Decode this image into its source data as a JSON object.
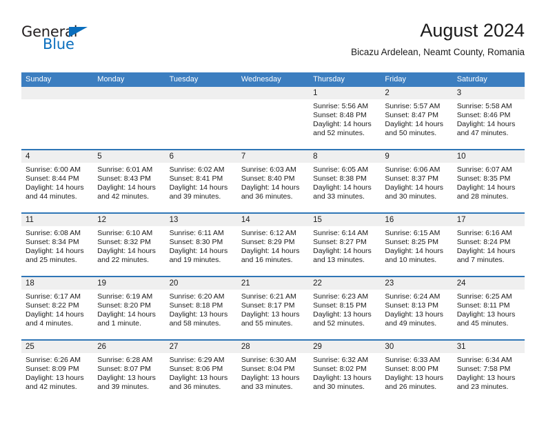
{
  "logo": {
    "word_top": "General",
    "word_bottom": "Blue",
    "triangle_icon": "triangle-icon",
    "color_dark": "#231f20",
    "color_blue": "#0a6ebd"
  },
  "header": {
    "title": "August 2024",
    "subtitle": "Bicazu Ardelean, Neamt County, Romania"
  },
  "colors": {
    "header_blue": "#3c7ec0",
    "separator_blue": "#2e75b6",
    "daynum_band": "#efefef",
    "text": "#1a1a1a"
  },
  "weekdays": [
    "Sunday",
    "Monday",
    "Tuesday",
    "Wednesday",
    "Thursday",
    "Friday",
    "Saturday"
  ],
  "weeks": [
    [
      {
        "day": "",
        "lines": []
      },
      {
        "day": "",
        "lines": []
      },
      {
        "day": "",
        "lines": []
      },
      {
        "day": "",
        "lines": []
      },
      {
        "day": "1",
        "lines": [
          "Sunrise: 5:56 AM",
          "Sunset: 8:48 PM",
          "Daylight: 14 hours",
          "and 52 minutes."
        ]
      },
      {
        "day": "2",
        "lines": [
          "Sunrise: 5:57 AM",
          "Sunset: 8:47 PM",
          "Daylight: 14 hours",
          "and 50 minutes."
        ]
      },
      {
        "day": "3",
        "lines": [
          "Sunrise: 5:58 AM",
          "Sunset: 8:46 PM",
          "Daylight: 14 hours",
          "and 47 minutes."
        ]
      }
    ],
    [
      {
        "day": "4",
        "lines": [
          "Sunrise: 6:00 AM",
          "Sunset: 8:44 PM",
          "Daylight: 14 hours",
          "and 44 minutes."
        ]
      },
      {
        "day": "5",
        "lines": [
          "Sunrise: 6:01 AM",
          "Sunset: 8:43 PM",
          "Daylight: 14 hours",
          "and 42 minutes."
        ]
      },
      {
        "day": "6",
        "lines": [
          "Sunrise: 6:02 AM",
          "Sunset: 8:41 PM",
          "Daylight: 14 hours",
          "and 39 minutes."
        ]
      },
      {
        "day": "7",
        "lines": [
          "Sunrise: 6:03 AM",
          "Sunset: 8:40 PM",
          "Daylight: 14 hours",
          "and 36 minutes."
        ]
      },
      {
        "day": "8",
        "lines": [
          "Sunrise: 6:05 AM",
          "Sunset: 8:38 PM",
          "Daylight: 14 hours",
          "and 33 minutes."
        ]
      },
      {
        "day": "9",
        "lines": [
          "Sunrise: 6:06 AM",
          "Sunset: 8:37 PM",
          "Daylight: 14 hours",
          "and 30 minutes."
        ]
      },
      {
        "day": "10",
        "lines": [
          "Sunrise: 6:07 AM",
          "Sunset: 8:35 PM",
          "Daylight: 14 hours",
          "and 28 minutes."
        ]
      }
    ],
    [
      {
        "day": "11",
        "lines": [
          "Sunrise: 6:08 AM",
          "Sunset: 8:34 PM",
          "Daylight: 14 hours",
          "and 25 minutes."
        ]
      },
      {
        "day": "12",
        "lines": [
          "Sunrise: 6:10 AM",
          "Sunset: 8:32 PM",
          "Daylight: 14 hours",
          "and 22 minutes."
        ]
      },
      {
        "day": "13",
        "lines": [
          "Sunrise: 6:11 AM",
          "Sunset: 8:30 PM",
          "Daylight: 14 hours",
          "and 19 minutes."
        ]
      },
      {
        "day": "14",
        "lines": [
          "Sunrise: 6:12 AM",
          "Sunset: 8:29 PM",
          "Daylight: 14 hours",
          "and 16 minutes."
        ]
      },
      {
        "day": "15",
        "lines": [
          "Sunrise: 6:14 AM",
          "Sunset: 8:27 PM",
          "Daylight: 14 hours",
          "and 13 minutes."
        ]
      },
      {
        "day": "16",
        "lines": [
          "Sunrise: 6:15 AM",
          "Sunset: 8:25 PM",
          "Daylight: 14 hours",
          "and 10 minutes."
        ]
      },
      {
        "day": "17",
        "lines": [
          "Sunrise: 6:16 AM",
          "Sunset: 8:24 PM",
          "Daylight: 14 hours",
          "and 7 minutes."
        ]
      }
    ],
    [
      {
        "day": "18",
        "lines": [
          "Sunrise: 6:17 AM",
          "Sunset: 8:22 PM",
          "Daylight: 14 hours",
          "and 4 minutes."
        ]
      },
      {
        "day": "19",
        "lines": [
          "Sunrise: 6:19 AM",
          "Sunset: 8:20 PM",
          "Daylight: 14 hours",
          "and 1 minute."
        ]
      },
      {
        "day": "20",
        "lines": [
          "Sunrise: 6:20 AM",
          "Sunset: 8:18 PM",
          "Daylight: 13 hours",
          "and 58 minutes."
        ]
      },
      {
        "day": "21",
        "lines": [
          "Sunrise: 6:21 AM",
          "Sunset: 8:17 PM",
          "Daylight: 13 hours",
          "and 55 minutes."
        ]
      },
      {
        "day": "22",
        "lines": [
          "Sunrise: 6:23 AM",
          "Sunset: 8:15 PM",
          "Daylight: 13 hours",
          "and 52 minutes."
        ]
      },
      {
        "day": "23",
        "lines": [
          "Sunrise: 6:24 AM",
          "Sunset: 8:13 PM",
          "Daylight: 13 hours",
          "and 49 minutes."
        ]
      },
      {
        "day": "24",
        "lines": [
          "Sunrise: 6:25 AM",
          "Sunset: 8:11 PM",
          "Daylight: 13 hours",
          "and 45 minutes."
        ]
      }
    ],
    [
      {
        "day": "25",
        "lines": [
          "Sunrise: 6:26 AM",
          "Sunset: 8:09 PM",
          "Daylight: 13 hours",
          "and 42 minutes."
        ]
      },
      {
        "day": "26",
        "lines": [
          "Sunrise: 6:28 AM",
          "Sunset: 8:07 PM",
          "Daylight: 13 hours",
          "and 39 minutes."
        ]
      },
      {
        "day": "27",
        "lines": [
          "Sunrise: 6:29 AM",
          "Sunset: 8:06 PM",
          "Daylight: 13 hours",
          "and 36 minutes."
        ]
      },
      {
        "day": "28",
        "lines": [
          "Sunrise: 6:30 AM",
          "Sunset: 8:04 PM",
          "Daylight: 13 hours",
          "and 33 minutes."
        ]
      },
      {
        "day": "29",
        "lines": [
          "Sunrise: 6:32 AM",
          "Sunset: 8:02 PM",
          "Daylight: 13 hours",
          "and 30 minutes."
        ]
      },
      {
        "day": "30",
        "lines": [
          "Sunrise: 6:33 AM",
          "Sunset: 8:00 PM",
          "Daylight: 13 hours",
          "and 26 minutes."
        ]
      },
      {
        "day": "31",
        "lines": [
          "Sunrise: 6:34 AM",
          "Sunset: 7:58 PM",
          "Daylight: 13 hours",
          "and 23 minutes."
        ]
      }
    ]
  ]
}
